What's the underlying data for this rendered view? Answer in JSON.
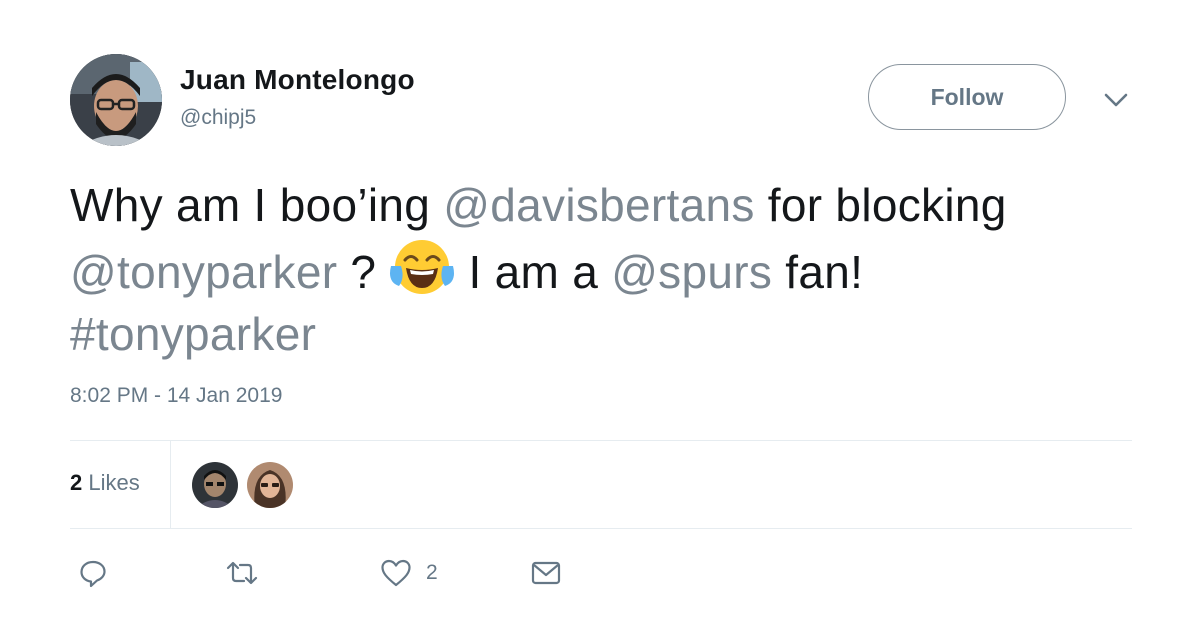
{
  "author": {
    "name": "Juan Montelongo",
    "handle": "@chipj5",
    "avatar_icon": "profile-photo-bearded-man-glasses"
  },
  "header": {
    "follow_label": "Follow",
    "more_icon": "chevron-down-icon"
  },
  "tweet": {
    "line1_text": "Why am I boo’ing ",
    "mention1": "@davisbertans",
    "line1_rest": " for blocking",
    "mention2": "@tonyparker",
    "line2_mid": " ? ",
    "emoji": "face-with-tears-of-joy",
    "line2_after_emoji": " I am a ",
    "mention3": "@spurs",
    "line2_end": " fan!",
    "hashtag": "#tonyparker",
    "timestamp": "8:02 PM - 14 Jan 2019"
  },
  "stats": {
    "likes_count": "2",
    "likes_label": " Likes",
    "likers": [
      "liker-avatar-1",
      "liker-avatar-2"
    ]
  },
  "actions": {
    "reply_icon": "reply-icon",
    "retweet_icon": "retweet-icon",
    "like_icon": "heart-icon",
    "like_count": "2",
    "dm_icon": "envelope-icon"
  },
  "colors": {
    "text": "#14171a",
    "secondary": "#657786",
    "link_gray": "#7b8690",
    "divider": "#e6ecf0"
  }
}
